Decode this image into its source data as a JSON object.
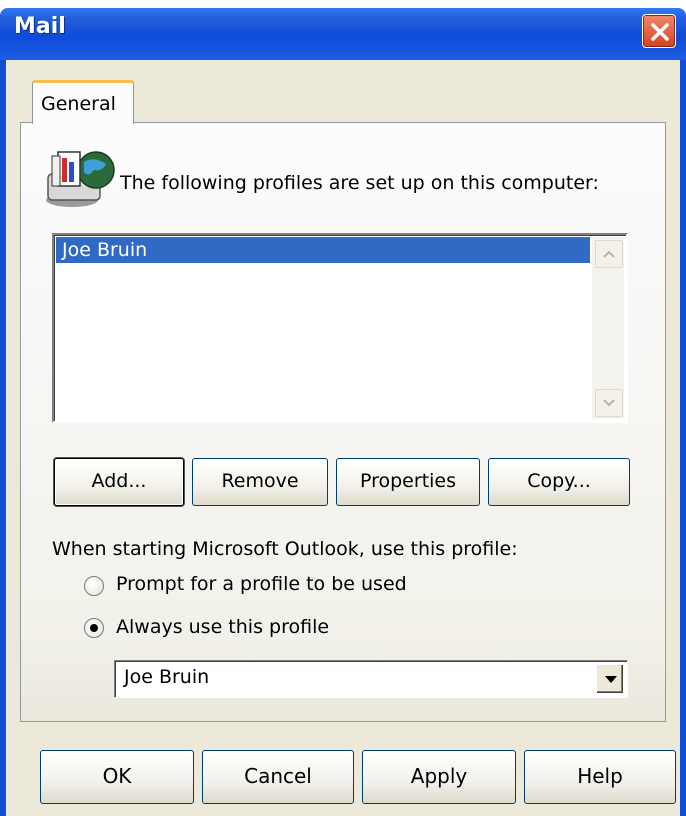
{
  "window": {
    "title": "Mail",
    "close_label": "×"
  },
  "tabs": [
    {
      "label": "General"
    }
  ],
  "profiles_section": {
    "caption": "The following profiles are set up on this computer:",
    "icon": "mail-profiles-icon",
    "profiles": [
      "Joe Bruin"
    ],
    "selected_index": 0
  },
  "profile_buttons": {
    "add": "Add...",
    "remove": "Remove",
    "properties": "Properties",
    "copy": "Copy..."
  },
  "startup": {
    "caption": "When starting Microsoft Outlook, use this profile:",
    "options": [
      {
        "label": "Prompt for a profile to be used",
        "checked": false
      },
      {
        "label": "Always use this profile",
        "checked": true
      }
    ],
    "selected_profile": "Joe Bruin"
  },
  "dialog_buttons": {
    "ok": "OK",
    "cancel": "Cancel",
    "apply": "Apply",
    "help": "Help"
  },
  "colors": {
    "title_bar": "#0e4bd8",
    "dialog_bg": "#ece9d8",
    "selection": "#316ac5",
    "close_button": "#d6401e",
    "tab_highlight": "#f6c04a"
  }
}
